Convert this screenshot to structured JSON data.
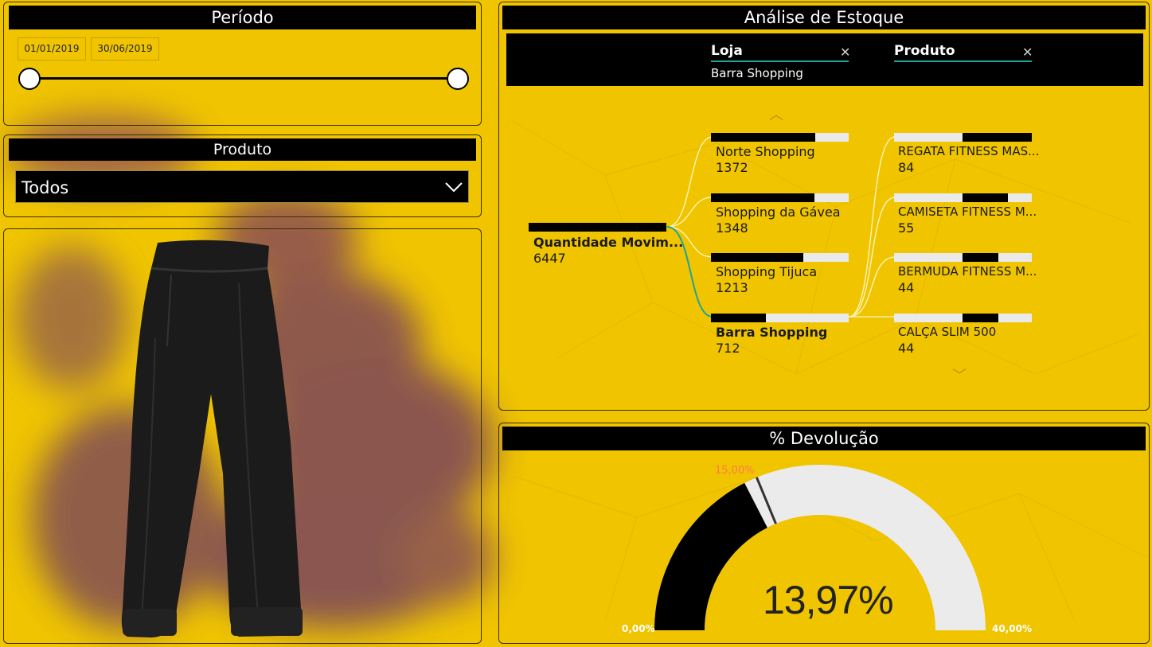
{
  "periodo": {
    "title": "Período",
    "start_date": "01/01/2019",
    "end_date": "30/06/2019"
  },
  "produto_filter": {
    "title": "Produto",
    "selected": "Todos"
  },
  "image": {
    "icon": "jogger-pants-image"
  },
  "estoque": {
    "title": "Análise de Estoque",
    "levels": [
      {
        "label": "Loja",
        "selected": "Barra Shopping"
      },
      {
        "label": "Produto",
        "selected": ""
      }
    ],
    "root": {
      "label": "Quantidade Movim...",
      "value": "6447",
      "fraction": 1.0
    },
    "lojas": [
      {
        "label": "Norte Shopping",
        "value": "1372",
        "fraction": 0.76
      },
      {
        "label": "Shopping da Gávea",
        "value": "1348",
        "fraction": 0.75
      },
      {
        "label": "Shopping Tijuca",
        "value": "1213",
        "fraction": 0.67
      },
      {
        "label": "Barra Shopping",
        "value": "712",
        "fraction": 0.4,
        "selected": true
      }
    ],
    "produtos": [
      {
        "label": "REGATA FITNESS MAS...",
        "value": "84",
        "fraction": 0.5
      },
      {
        "label": "CAMISETA FITNESS M...",
        "value": "55",
        "fraction": 0.33
      },
      {
        "label": "BERMUDA FITNESS M...",
        "value": "44",
        "fraction": 0.26
      },
      {
        "label": "CALÇA SLIM 500",
        "value": "44",
        "fraction": 0.26
      }
    ]
  },
  "devolucao": {
    "title": "% Devolução",
    "value_label": "13,97%",
    "value": 13.97,
    "target_label": "15,00%",
    "target": 15.0,
    "min_label": "0,00%",
    "max_label": "40,00%",
    "min": 0,
    "max": 40,
    "colors": {
      "fill": "#000000",
      "track": "#ebebeb",
      "target": "#ff8c5a"
    }
  },
  "colors": {
    "background": "#f0c500",
    "accent": "#1fa39a"
  }
}
